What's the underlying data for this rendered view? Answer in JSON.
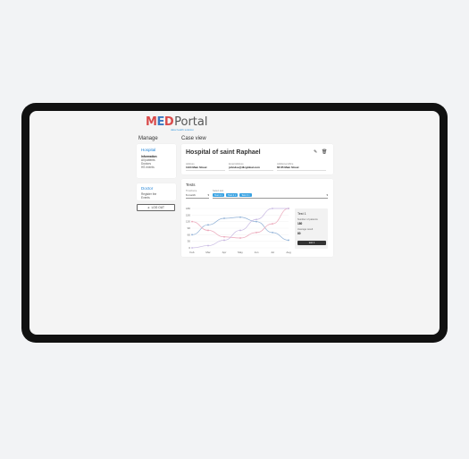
{
  "brand": {
    "name_part1": "M",
    "name_part2": "E",
    "name_part3": "D",
    "name_part4": "Portal",
    "tagline": "data health solution"
  },
  "sidebar": {
    "title": "Manage",
    "hospital": {
      "heading": "Hospital",
      "items": [
        "Information",
        "All patients",
        "Doctors",
        "HS events"
      ]
    },
    "doctor": {
      "heading": "Doctor",
      "items": [
        "Register the",
        "Events"
      ]
    },
    "logout_label": "LOG OUT"
  },
  "case": {
    "title": "Case view",
    "hospital_name": "Hospital of saint Raphael",
    "fields": [
      {
        "label": "Address",
        "value": "1134 Main Street"
      },
      {
        "label": "Email Address",
        "value": "johndoe@dlcglobal.com"
      },
      {
        "label": "Additional office",
        "value": "66 85 Main Street"
      }
    ]
  },
  "tests": {
    "heading": "Tests",
    "timeframe_label": "Timeframe",
    "timeframe_value": "6 month",
    "select_test_label": "Select test",
    "chips": [
      "Test 1",
      "Test 2",
      "Test 3"
    ],
    "summary": {
      "title": "Test 1",
      "patients_label": "Number of patients",
      "patients_value": "180",
      "avg_label": "Average result",
      "avg_value": "80",
      "button_label": "test 1"
    }
  },
  "chart_data": {
    "type": "line",
    "categories": [
      "Feb",
      "Mar",
      "Apr",
      "May",
      "Jun",
      "Jul",
      "Aug"
    ],
    "ylim": [
      0,
      180
    ],
    "yticks": [
      0,
      30,
      60,
      90,
      120,
      150,
      180
    ],
    "series": [
      {
        "color": "#8fb0d6",
        "values": [
          60,
          105,
          135,
          140,
          120,
          70,
          35
        ]
      },
      {
        "color": "#eaa5b8",
        "values": [
          120,
          80,
          50,
          45,
          70,
          110,
          180
        ]
      },
      {
        "color": "#c7b8e2",
        "values": [
          0,
          10,
          35,
          80,
          130,
          180,
          180
        ]
      }
    ]
  },
  "colors": {
    "accent": "#1f82d6",
    "chip": "#3aa3e3",
    "brand_red": "#d94b4b"
  }
}
